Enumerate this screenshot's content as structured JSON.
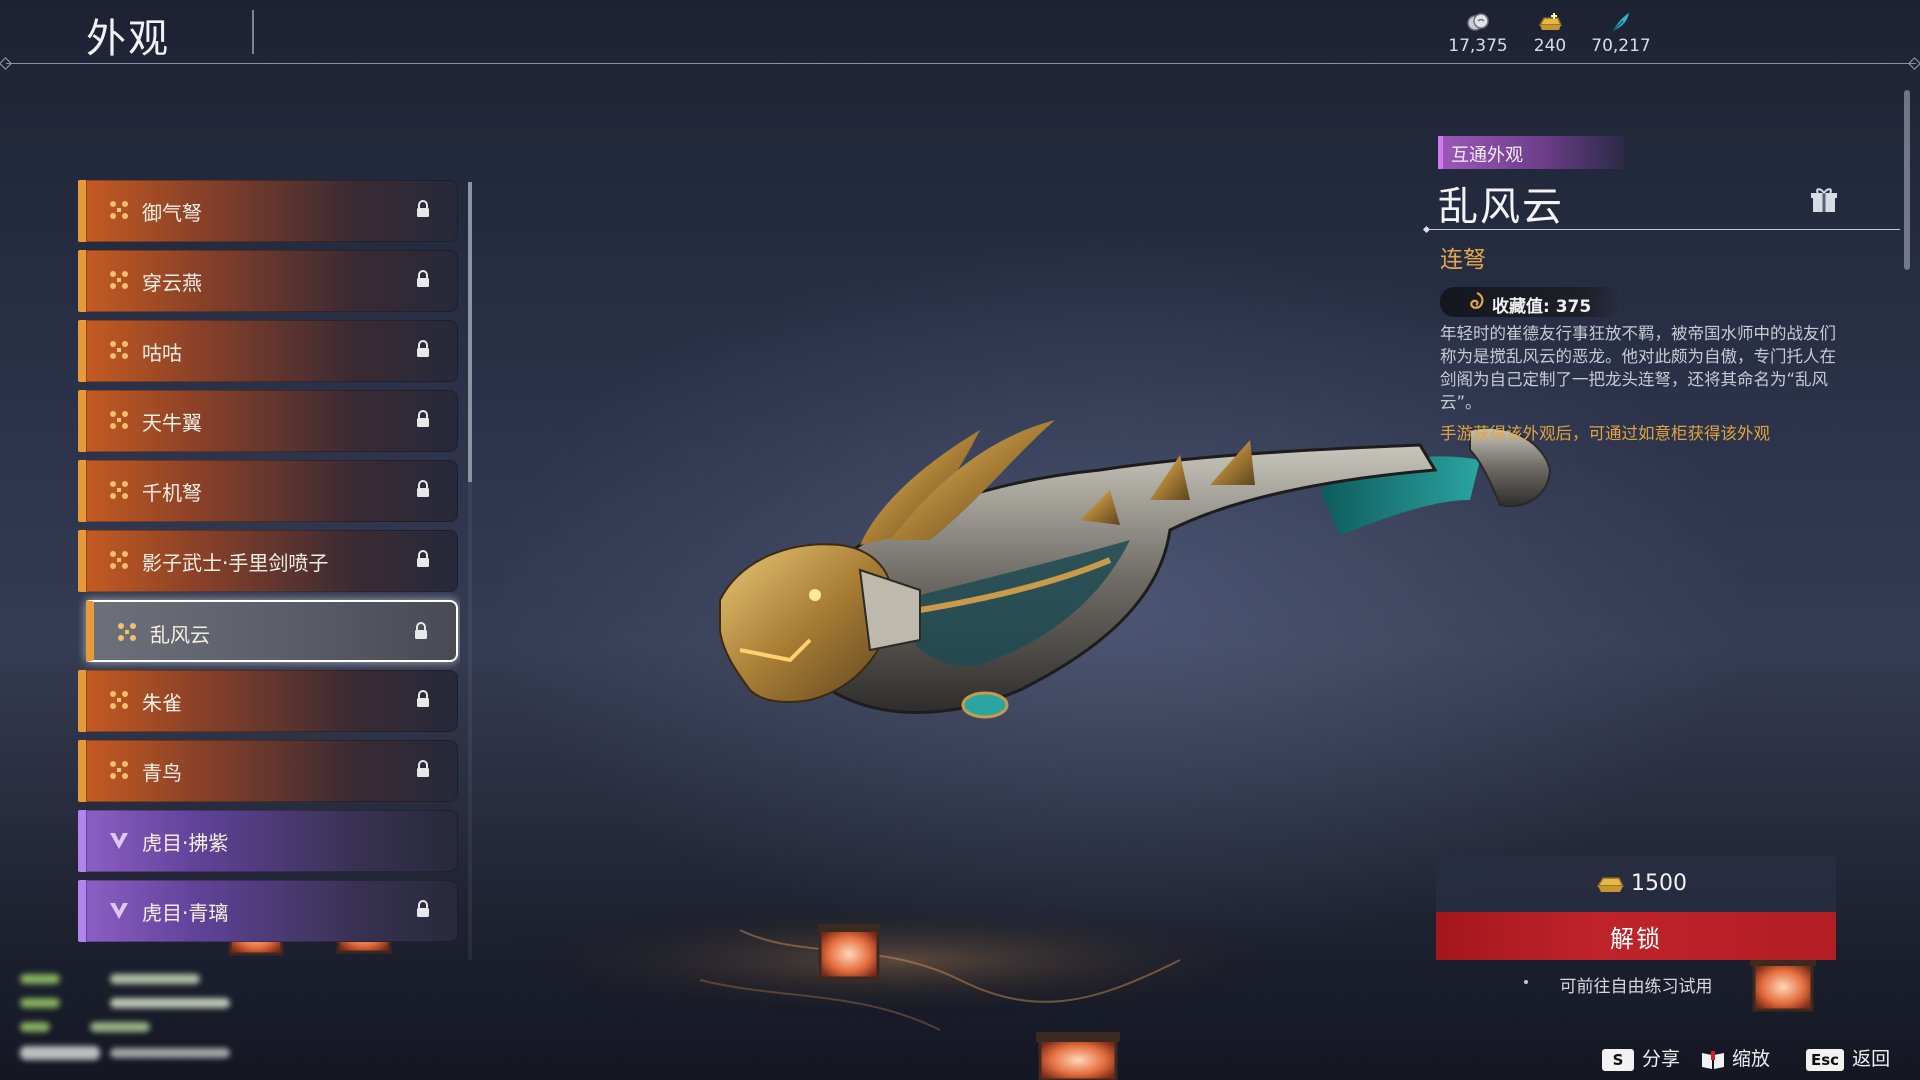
{
  "header": {
    "title": "外观",
    "currencies": [
      {
        "icon": "silver-coin-icon",
        "value": "17,375"
      },
      {
        "icon": "gold-ingot-icon",
        "value": "240"
      },
      {
        "icon": "feather-icon",
        "value": "70,217"
      }
    ]
  },
  "list": {
    "items": [
      {
        "label": "御气弩",
        "rarity": "orange",
        "locked": true
      },
      {
        "label": "穿云燕",
        "rarity": "orange",
        "locked": true
      },
      {
        "label": "咕咕",
        "rarity": "orange",
        "locked": true
      },
      {
        "label": "天牛翼",
        "rarity": "orange",
        "locked": true
      },
      {
        "label": "千机弩",
        "rarity": "orange",
        "locked": true
      },
      {
        "label": "影子武士·手里剑喷子",
        "rarity": "orange",
        "locked": true
      },
      {
        "label": "乱风云",
        "rarity": "orange",
        "locked": true,
        "selected": true
      },
      {
        "label": "朱雀",
        "rarity": "orange",
        "locked": true
      },
      {
        "label": "青鸟",
        "rarity": "orange",
        "locked": true
      },
      {
        "label": "虎目·拂紫",
        "rarity": "purple",
        "locked": false
      },
      {
        "label": "虎目·青璃",
        "rarity": "purple",
        "locked": true
      }
    ]
  },
  "detail": {
    "tag": "互通外观",
    "name": "乱风云",
    "type": "连弩",
    "collection_label": "收藏值: 375",
    "description": "年轻时的崔德友行事狂放不羁，被帝国水师中的战友们称为是搅乱风云的恶龙。他对此颇为自傲，专门托人在剑阁为自己定制了一把龙头连弩，还将其命名为“乱风云”。",
    "hint": "手游获得该外观后，可通过如意柜获得该外观",
    "price": "1500",
    "unlock_label": "解锁",
    "trial_text": "可前往自由练习试用"
  },
  "footer": {
    "controls": [
      {
        "key": "S",
        "label": "分享"
      },
      {
        "key": "",
        "label": "缩放"
      },
      {
        "key": "Esc",
        "label": "返回"
      }
    ]
  },
  "colors": {
    "orange_accent": "#e59a3c",
    "purple_accent": "#b184ee",
    "type_gold": "#e3a84c",
    "unlock_red": "#c0232a"
  }
}
